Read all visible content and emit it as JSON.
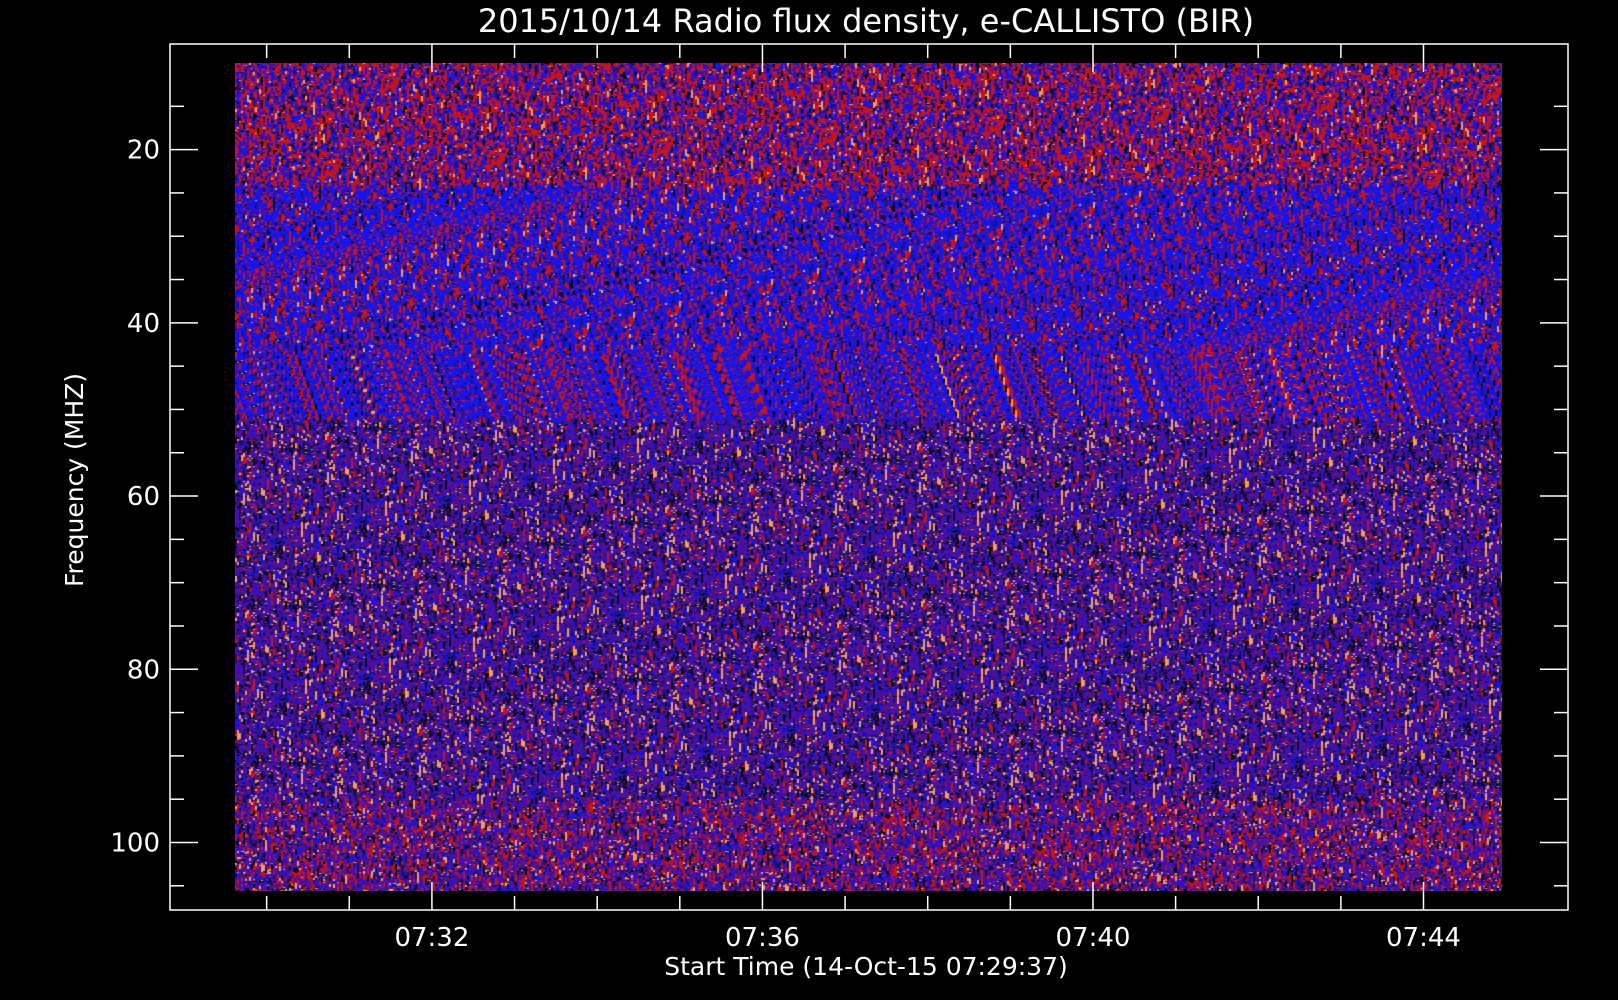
{
  "chart_data": {
    "type": "heatmap",
    "title": "2015/10/14  Radio flux density, e-CALLISTO (BIR)",
    "xlabel": "Start Time (14-Oct-15 07:29:37)",
    "ylabel": "Frequency (MHZ)",
    "x_tick_labels": [
      "07:32",
      "07:36",
      "07:40",
      "07:44"
    ],
    "x_tick_minutes": [
      32,
      36,
      40,
      44
    ],
    "x_range_minutes": [
      29.617,
      44.95
    ],
    "y_tick_labels": [
      "20",
      "40",
      "60",
      "80",
      "100"
    ],
    "y_tick_values": [
      20,
      40,
      60,
      80,
      100
    ],
    "y_range_mhz": [
      10,
      105.6
    ],
    "y_axis_inverted": true,
    "bands": [
      {
        "from_mhz": 10,
        "to_mhz": 24,
        "dominant": "red/blue noise"
      },
      {
        "from_mhz": 24,
        "to_mhz": 51,
        "dominant": "blue with red speckle"
      },
      {
        "from_mhz": 51,
        "to_mhz": 95,
        "dominant": "purple/black with orange speckle"
      },
      {
        "from_mhz": 95,
        "to_mhz": 105.6,
        "dominant": "purple/red noise"
      }
    ],
    "colors": {
      "background": "#000000",
      "axes": "#ffffff",
      "blue": "#1414f0",
      "red": "#c81414",
      "purple": "#4b10a0",
      "orange": "#f5a050"
    }
  }
}
